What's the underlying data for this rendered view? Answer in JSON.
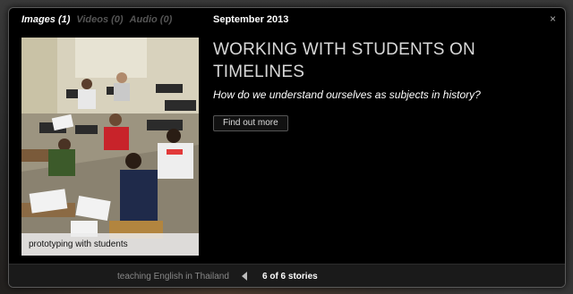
{
  "topbar": {
    "tabs": [
      {
        "label": "Images (1)",
        "active": true
      },
      {
        "label": "Videos (0)",
        "active": false
      },
      {
        "label": "Audio (0)",
        "active": false
      }
    ],
    "date": "September 2013",
    "close_label": "×"
  },
  "photo": {
    "caption": "prototyping with students"
  },
  "story": {
    "title": "WORKING WITH STUDENTS ON TIMELINES",
    "subtitle": "How do we understand ourselves as subjects in history?",
    "button_label": "Find out more"
  },
  "footer": {
    "previous_story": "teaching English in Thailand",
    "counter": "6 of 6 stories"
  },
  "colors": {
    "modal_bg": "#000000",
    "title": "#d8d8d8",
    "inactive_tab": "#555555"
  }
}
